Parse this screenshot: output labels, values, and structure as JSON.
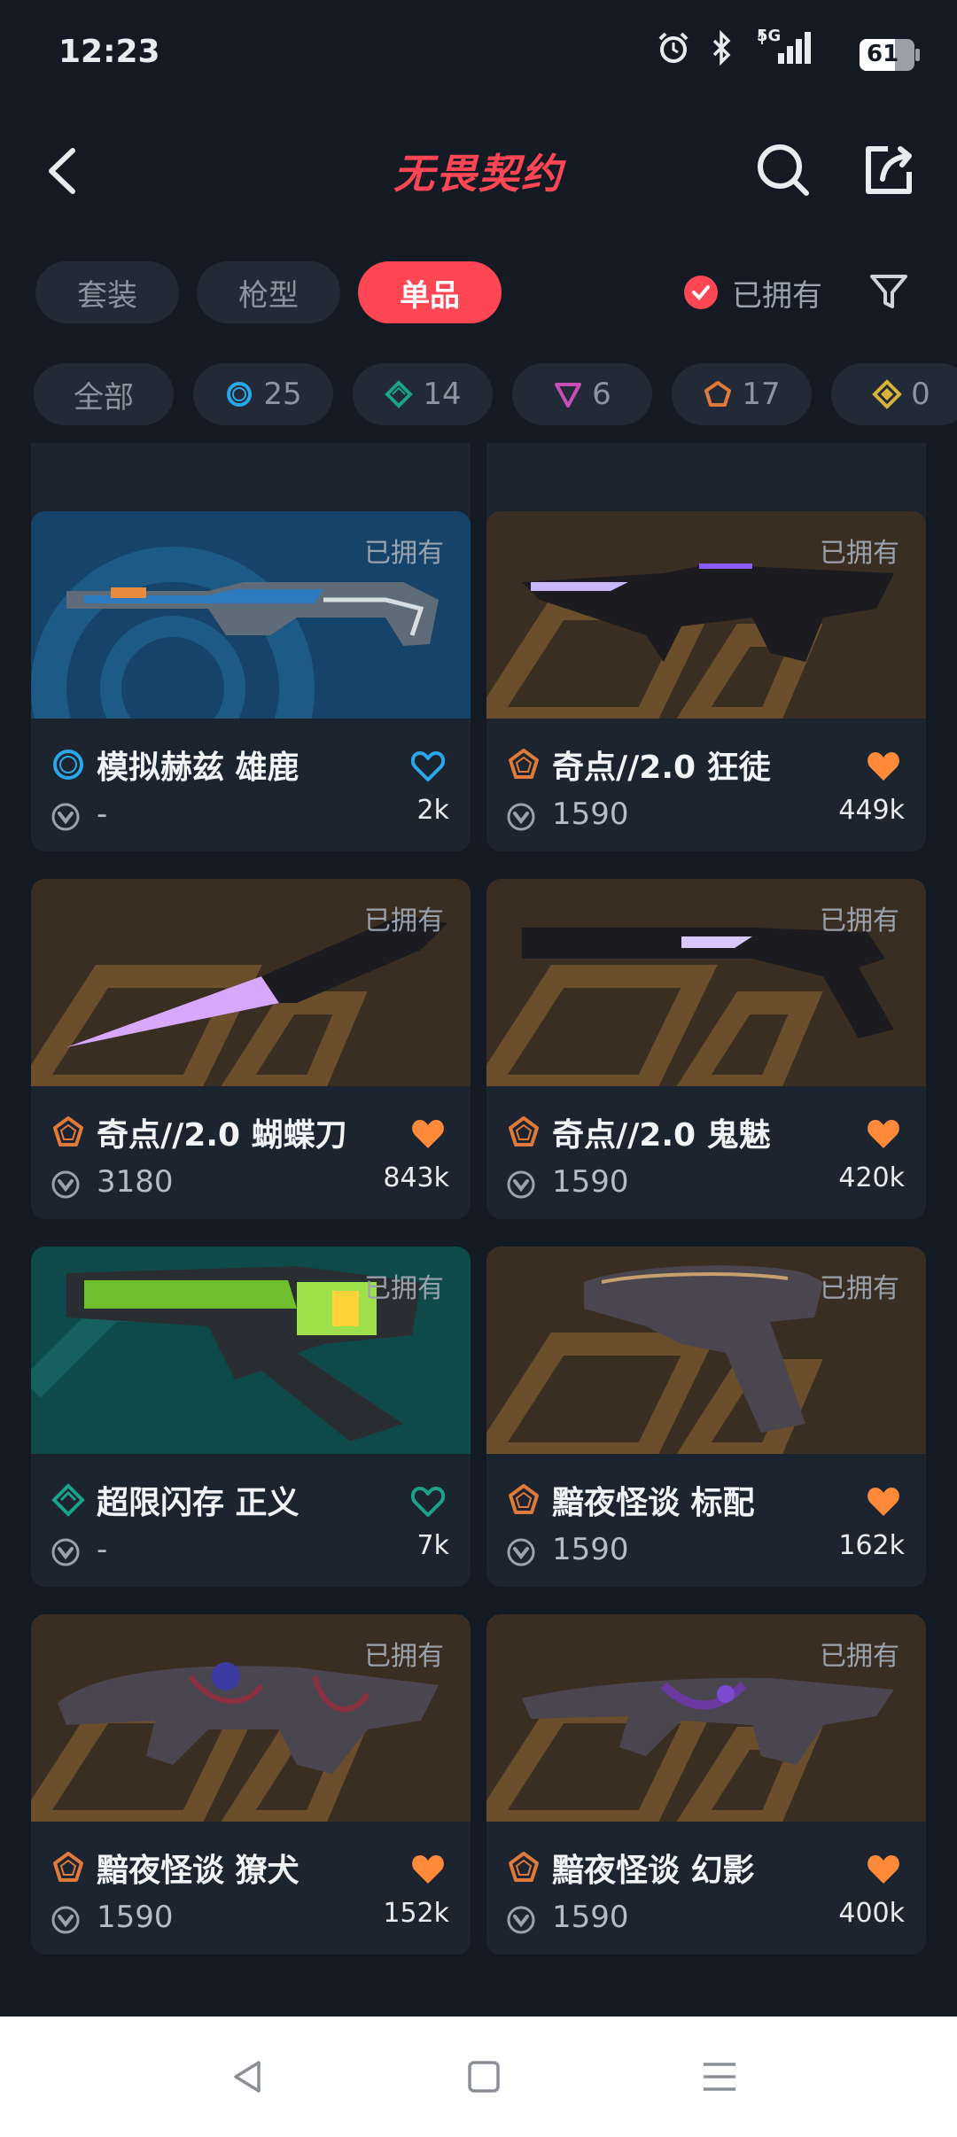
{
  "status_bar": {
    "time": "12:23",
    "network": "5G",
    "battery": "61"
  },
  "header": {
    "title": "无畏契约"
  },
  "tabs": [
    {
      "label": "套装",
      "active": false
    },
    {
      "label": "枪型",
      "active": false
    },
    {
      "label": "单品",
      "active": true
    }
  ],
  "owned_filter": {
    "label": "已拥有",
    "checked": true
  },
  "rarity_chips": [
    {
      "label": "全部",
      "icon": ""
    },
    {
      "label": "25",
      "icon": "select-edition",
      "color": "#2aa7e8"
    },
    {
      "label": "14",
      "icon": "deluxe-edition",
      "color": "#1aa38a"
    },
    {
      "label": "6",
      "icon": "premium-edition",
      "color": "#c64eb4"
    },
    {
      "label": "17",
      "icon": "exclusive-edition",
      "color": "#e07a3b"
    },
    {
      "label": "0",
      "icon": "ultra-edition",
      "color": "#d7b33a"
    }
  ],
  "cards": [
    {
      "name": "模拟赫兹 雄鹿",
      "price": "-",
      "likes": "2k",
      "owned": "已拥有",
      "rarity": "select-edition",
      "heart": "outline-blue"
    },
    {
      "name": "奇点//2.0 狂徒",
      "price": "1590",
      "likes": "449k",
      "owned": "已拥有",
      "rarity": "exclusive-edition",
      "heart": "filled-orange"
    },
    {
      "name": "奇点//2.0 蝴蝶刀",
      "price": "3180",
      "likes": "843k",
      "owned": "已拥有",
      "rarity": "exclusive-edition",
      "heart": "filled-orange"
    },
    {
      "name": "奇点//2.0 鬼魅",
      "price": "1590",
      "likes": "420k",
      "owned": "已拥有",
      "rarity": "exclusive-edition",
      "heart": "filled-orange"
    },
    {
      "name": "超限闪存 正义",
      "price": "-",
      "likes": "7k",
      "owned": "已拥有",
      "rarity": "deluxe-edition",
      "heart": "outline-green"
    },
    {
      "name": "黯夜怪谈 标配",
      "price": "1590",
      "likes": "162k",
      "owned": "已拥有",
      "rarity": "exclusive-edition",
      "heart": "filled-orange"
    },
    {
      "name": "黯夜怪谈 獠犬",
      "price": "1590",
      "likes": "152k",
      "owned": "已拥有",
      "rarity": "exclusive-edition",
      "heart": "filled-orange"
    },
    {
      "name": "黯夜怪谈 幻影",
      "price": "1590",
      "likes": "400k",
      "owned": "已拥有",
      "rarity": "exclusive-edition",
      "heart": "filled-orange"
    }
  ]
}
